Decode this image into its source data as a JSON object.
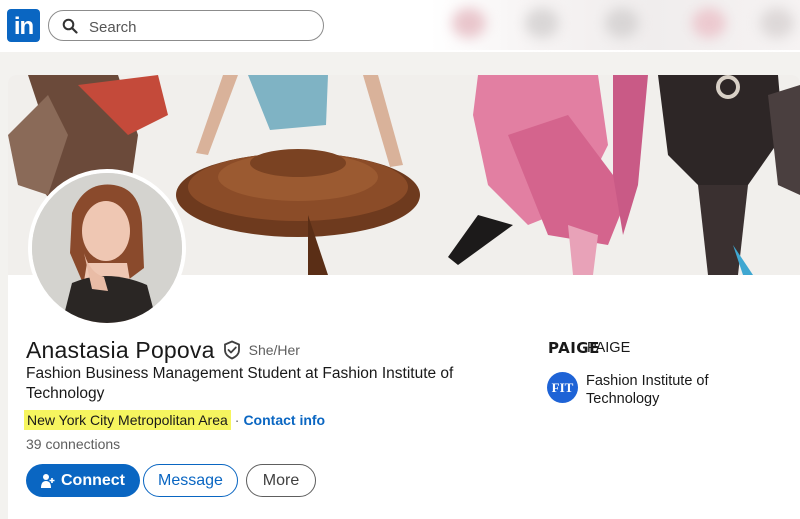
{
  "nav": {
    "logo_text": "in",
    "search_placeholder": "Search"
  },
  "profile": {
    "name": "Anastasia Popova",
    "pronouns": "She/Her",
    "headline": "Fashion Business Management Student at Fashion Institute of Technology",
    "location": "New York City Metropolitan Area",
    "separator": "·",
    "contact_info": "Contact info",
    "connections": "39 connections"
  },
  "actions": {
    "connect": "Connect",
    "message": "Message",
    "more": "More"
  },
  "experience": {
    "company_logo_text": "PAIGE",
    "company_name": "PAIGE"
  },
  "education": {
    "school_logo_text": "FIT",
    "school_name": "Fashion Institute of Technology"
  },
  "colors": {
    "brand": "#0a66c2",
    "highlight": "#f6f55f",
    "fit_blue": "#1e63d6"
  }
}
